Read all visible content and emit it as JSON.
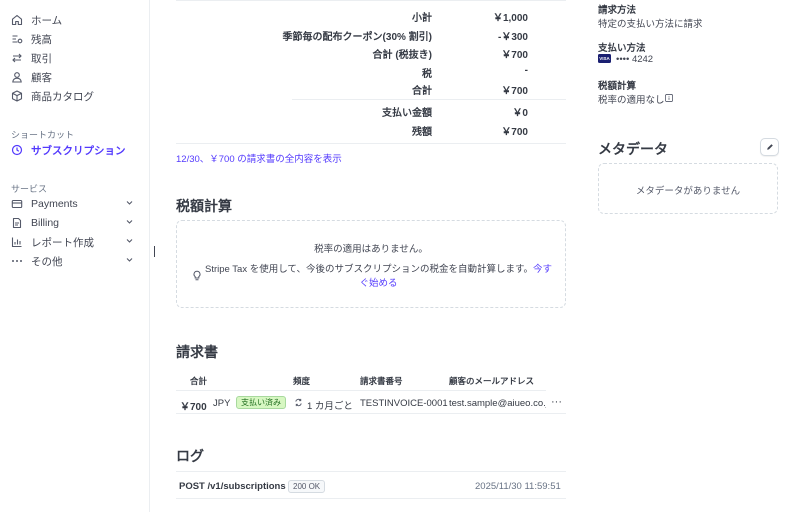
{
  "sidebar": {
    "items": [
      {
        "label": "ホーム",
        "icon": "home-icon"
      },
      {
        "label": "残高",
        "icon": "balance-icon"
      },
      {
        "label": "取引",
        "icon": "transactions-icon"
      },
      {
        "label": "顧客",
        "icon": "customer-icon"
      },
      {
        "label": "商品カタログ",
        "icon": "product-catalog-icon"
      }
    ],
    "shortcuts_label": "ショートカット",
    "shortcut_item": {
      "label": "サブスクリプション",
      "icon": "clock-icon"
    },
    "services_label": "サービス",
    "service_items": [
      {
        "label": "Payments",
        "icon": "payments-icon"
      },
      {
        "label": "Billing",
        "icon": "billing-icon"
      },
      {
        "label": "レポート作成",
        "icon": "reports-icon"
      },
      {
        "label": "その他",
        "icon": "more-icon"
      }
    ]
  },
  "summary": {
    "rows": [
      {
        "label": "小計",
        "value": "￥1,000"
      },
      {
        "label": "季節毎の配布クーポン(30% 割引)",
        "value": "-￥300"
      },
      {
        "label": "合計 (税抜き)",
        "value": "￥700"
      },
      {
        "label": "税",
        "value": "-"
      },
      {
        "label": "合計",
        "value": "￥700"
      },
      {
        "label": "支払い金額",
        "value": "￥0"
      },
      {
        "label": "残額",
        "value": "￥700"
      }
    ],
    "view_full_invoice_link": "12/30、￥700 の請求書の全内容を表示"
  },
  "tax": {
    "title": "税額計算",
    "empty_text": "税率の適用はありません。",
    "tip_text": "Stripe Tax を使用して、今後のサブスクリプションの税金を自動計算します。",
    "tip_link": "今すぐ始める"
  },
  "invoices": {
    "title": "請求書",
    "columns": [
      "合計",
      "頻度",
      "請求書番号",
      "顧客のメールアドレス"
    ],
    "rows": [
      {
        "amount": "￥700",
        "currency": "JPY",
        "status": "支払い済み",
        "frequency": "1 カ月ごと",
        "number": "TESTINVOICE-0001",
        "email": "test.sample@aiueo.co.jp",
        "more": "···"
      }
    ]
  },
  "logs": {
    "title": "ログ",
    "rows": [
      {
        "request": "POST /v1/subscriptions",
        "status": "200 OK",
        "time": "2025/11/30 11:59:51"
      }
    ]
  },
  "details": {
    "billing_method_label": "請求方法",
    "billing_method_value": "特定の支払い方法に請求",
    "payment_method_label": "支払い方法",
    "card_brand": "VISA",
    "card_last4": "•••• 4242",
    "tax_calc_label": "税額計算",
    "tax_calc_value": "税率の適用なし"
  },
  "metadata": {
    "title": "メタデータ",
    "empty_text": "メタデータがありません"
  },
  "colors": {
    "accent": "#533afd",
    "success_bg": "#d7f7c2",
    "success_text": "#216e20",
    "border": "#ebeef1"
  }
}
